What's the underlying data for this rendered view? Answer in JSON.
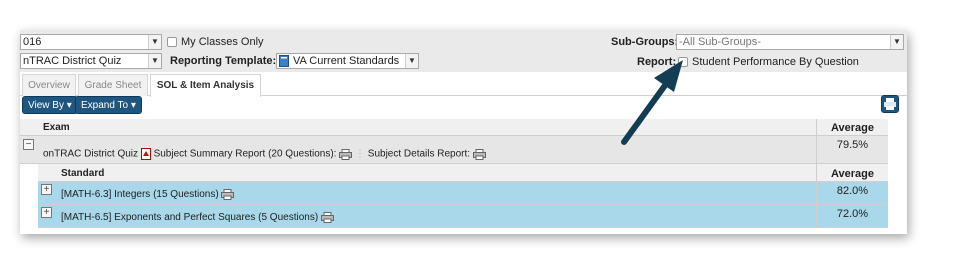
{
  "filters": {
    "year_value": "016",
    "my_classes_label": "My Classes Only",
    "quiz_value": "nTRAC District Quiz",
    "reporting_template_label": "Reporting Template:",
    "template_value": "VA Current Standards",
    "subgroups_label": "Sub-Groups:",
    "subgroups_value": "-All Sub-Groups-",
    "report_label": "Report:",
    "report_option_label": "Student Performance By Question"
  },
  "tabs": [
    {
      "label": "Overview"
    },
    {
      "label": "Grade Sheet"
    },
    {
      "label": "SOL & Item Analysis",
      "active": true
    }
  ],
  "toolbar": {
    "view_by_label": "View By ▾",
    "expand_to_label": "Expand To ▾"
  },
  "grid": {
    "header": {
      "exam": "Exam",
      "average": "Average"
    },
    "exam_row": {
      "expander": "−",
      "name": "onTRAC District Quiz",
      "summary_label": "Subject Summary Report (20 Questions):",
      "details_label": "Subject Details Report:",
      "average": "79.5%"
    },
    "sub_header": {
      "standard": "Standard",
      "average": "Average"
    },
    "standards": [
      {
        "expander": "+",
        "label": "[MATH-6.3] Integers (15 Questions)",
        "average": "82.0%"
      },
      {
        "expander": "+",
        "label": "[MATH-6.5] Exponents and Perfect Squares (5 Questions)",
        "average": "72.0%"
      }
    ]
  },
  "colors": {
    "accent": "#1f567f",
    "row_highlight": "#a8d8ea",
    "arrow": "#143d54"
  }
}
